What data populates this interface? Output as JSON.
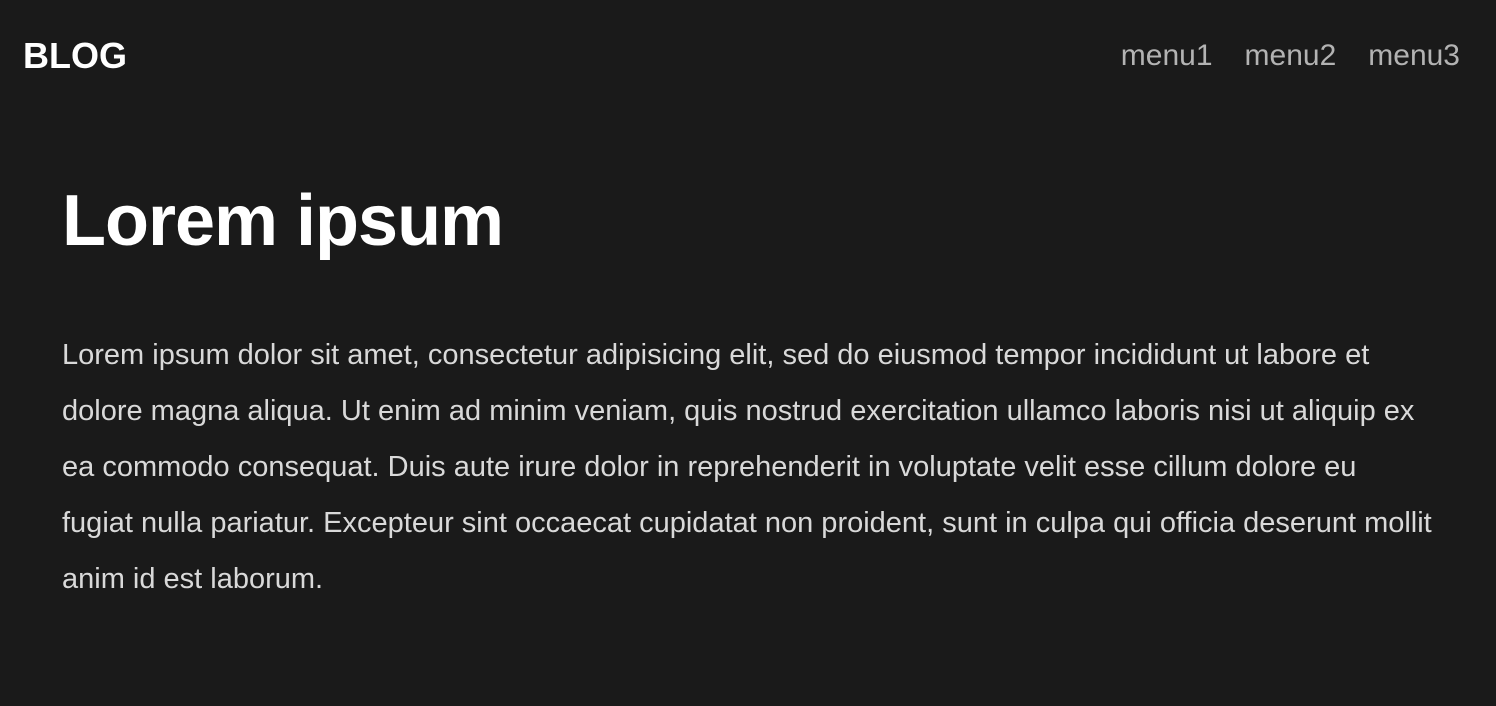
{
  "header": {
    "brand": "BLOG",
    "menu": [
      {
        "label": "menu1"
      },
      {
        "label": "menu2"
      },
      {
        "label": "menu3"
      }
    ]
  },
  "article": {
    "title": "Lorem ipsum",
    "body": "Lorem ipsum dolor sit amet, consectetur adipisicing elit, sed do eiusmod tempor incididunt ut labore et dolore magna aliqua. Ut enim ad minim veniam, quis nostrud exercitation ullamco laboris nisi ut aliquip ex ea commodo consequat. Duis aute irure dolor in reprehenderit in voluptate velit esse cillum dolore eu fugiat nulla pariatur. Excepteur sint occaecat cupidatat non proident, sunt in culpa qui officia deserunt mollit anim id est laborum."
  },
  "colors": {
    "background": "#1a1a1a",
    "brand_text": "#ffffff",
    "menu_text": "#b3b3b3",
    "title_text": "#ffffff",
    "body_text": "#d9d9d9"
  }
}
